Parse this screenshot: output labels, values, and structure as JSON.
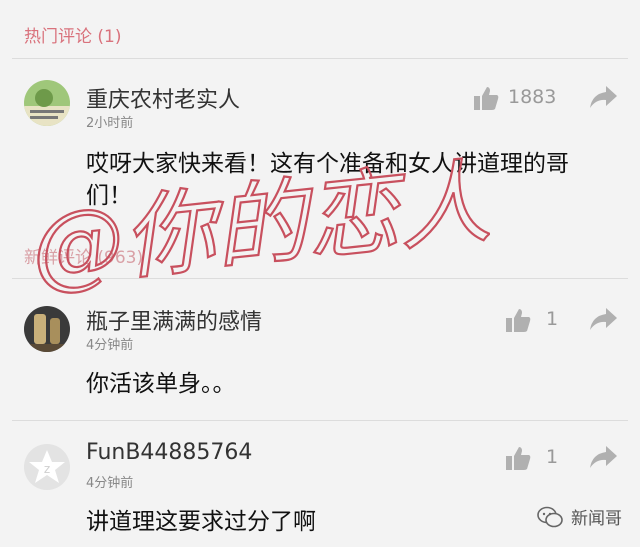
{
  "sections": {
    "hot_header": "热门评论 (1)",
    "new_header": "新鲜评论 (963)"
  },
  "comments": [
    {
      "username": "重庆农村老实人",
      "time": "2小时前",
      "likes": "1883",
      "text_line1": "哎呀大家快来看！这有个准备和女人讲道理的哥",
      "text_line2": "们！"
    },
    {
      "username": "瓶子里满满的感情",
      "time": "4分钟前",
      "likes": "1",
      "text_line1": "你活该单身。。"
    },
    {
      "username": "FunB44885764",
      "time": "4分钟前",
      "likes": "1",
      "text_line1": "讲道理这要求过分了啊"
    }
  ],
  "watermark_text": "@你的恋人",
  "brand": "新闻哥",
  "colors": {
    "section_header": "#d9727c",
    "watermark": "#c8505e",
    "icon_gray": "#b0b0b0"
  }
}
